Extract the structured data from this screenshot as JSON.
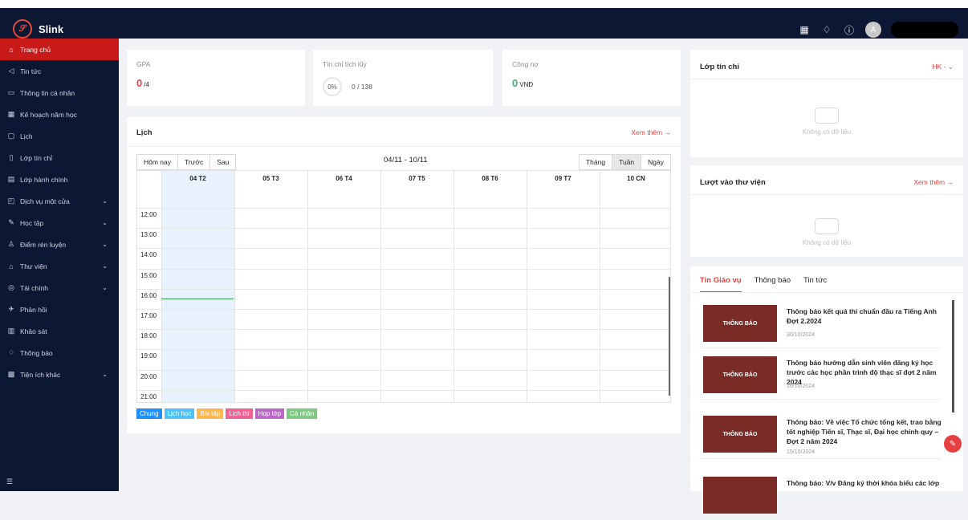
{
  "app": {
    "name": "Slink",
    "avatar_letter": "A",
    "username": ""
  },
  "sidebar": {
    "items": [
      {
        "label": "Trang chủ",
        "icon": "home-icon",
        "active": true
      },
      {
        "label": "Tin tức",
        "icon": "megaphone-icon"
      },
      {
        "label": "Thông tin cá nhân",
        "icon": "id-card-icon"
      },
      {
        "label": "Kế hoạch năm học",
        "icon": "table-icon"
      },
      {
        "label": "Lịch",
        "icon": "calendar-icon"
      },
      {
        "label": "Lớp tín chỉ",
        "icon": "book-icon"
      },
      {
        "label": "Lớp hành chính",
        "icon": "file-icon"
      },
      {
        "label": "Dịch vụ một cửa",
        "icon": "service-icon",
        "expand": true
      },
      {
        "label": "Học tập",
        "icon": "pen-icon",
        "expand": true
      },
      {
        "label": "Điểm rèn luyện",
        "icon": "user-icon",
        "expand": true
      },
      {
        "label": "Thư viện",
        "icon": "library-icon",
        "expand": true
      },
      {
        "label": "Tài chính",
        "icon": "finance-icon",
        "expand": true
      },
      {
        "label": "Phản hồi",
        "icon": "feedback-icon"
      },
      {
        "label": "Khảo sát",
        "icon": "survey-icon"
      },
      {
        "label": "Thông báo",
        "icon": "bell-icon"
      },
      {
        "label": "Tiện ích khác",
        "icon": "apps-icon",
        "expand": true
      }
    ]
  },
  "stats": {
    "gpa": {
      "label": "GPA",
      "value": "0",
      "suffix": "/4"
    },
    "credits": {
      "label": "Tín chỉ tích lũy",
      "percent": "0%",
      "value": "0 / 138"
    },
    "debt": {
      "label": "Công nợ",
      "value": "0",
      "suffix": "VNĐ"
    }
  },
  "schedule": {
    "title": "Lịch",
    "more": "Xem thêm →",
    "nav": [
      "Hôm nay",
      "Trước",
      "Sau"
    ],
    "range": "04/11 - 10/11",
    "views": [
      "Tháng",
      "Tuần",
      "Ngày"
    ],
    "days": [
      "04 T2",
      "05 T3",
      "06 T4",
      "07 T5",
      "08 T6",
      "09 T7",
      "10 CN"
    ],
    "times": [
      "12:00",
      "13:00",
      "14:00",
      "15:00",
      "16:00",
      "17:00",
      "18:00",
      "19:00",
      "20:00",
      "21:00"
    ],
    "legend": [
      {
        "label": "Chung",
        "color": "#1e90ff"
      },
      {
        "label": "Lịch học",
        "color": "#4fc3f7"
      },
      {
        "label": "Bài tập",
        "color": "#ffb74d"
      },
      {
        "label": "Lịch thi",
        "color": "#f06292"
      },
      {
        "label": "Họp lớp",
        "color": "#ba68c8"
      },
      {
        "label": "Cá nhân",
        "color": "#81c784"
      }
    ]
  },
  "credit_classes": {
    "title": "Lớp tín chỉ",
    "semester": "HK -",
    "empty": "Không có dữ liệu"
  },
  "library": {
    "title": "Lượt vào thư viện",
    "more": "Xem thêm →",
    "empty": "Không có dữ liệu"
  },
  "news": {
    "tabs": [
      "Tin Giáo vụ",
      "Thông báo",
      "Tin tức"
    ],
    "items": [
      {
        "title": "Thông báo kết quả thi chuẩn đầu ra Tiếng Anh Đợt 2.2024",
        "date": "30/10/2024",
        "thumb": "THÔNG BÁO"
      },
      {
        "title": "Thông báo hướng dẫn sinh viên đăng ký học trước các học phần trình độ thạc sĩ đợt 2 năm 2024",
        "date": "16/10/2024",
        "thumb": "THÔNG BÁO"
      },
      {
        "title": "Thông báo: Về việc Tổ chức tổng kết, trao bằng tốt nghiệp Tiến sĩ, Thạc sĩ, Đại học chính quy – Đợt 2 năm 2024",
        "date": "15/10/2024",
        "thumb": "THÔNG BÁO"
      },
      {
        "title": "Thông báo: V/v Đăng ký thời khóa biểu các lớp",
        "date": "",
        "thumb": ""
      }
    ]
  }
}
